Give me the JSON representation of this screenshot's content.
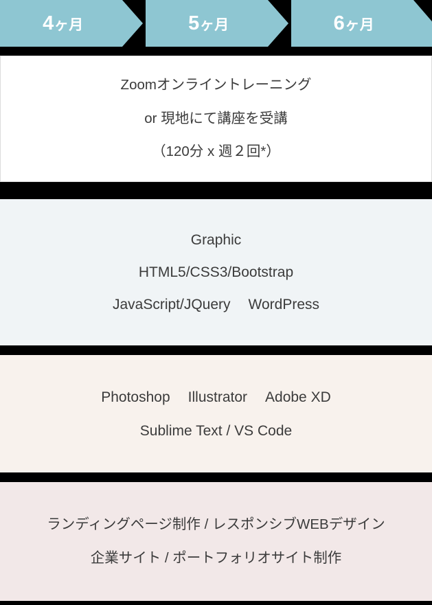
{
  "colors": {
    "chevron": "#8ec6d2",
    "chevron_text": "#ffffff",
    "separator": "#000000",
    "band_training_bg": "#ffffff",
    "band_skills_bg": "#f0f4f6",
    "band_tools_bg": "#f8f2ed",
    "band_deliverables_bg": "#f2e8e8",
    "body_text": "#3b3b3b"
  },
  "timeline": {
    "steps": [
      {
        "number": "4",
        "unit": "ヶ月",
        "full": "4ヶ月"
      },
      {
        "number": "5",
        "unit": "ヶ月",
        "full": "5ヶ月"
      },
      {
        "number": "6",
        "unit": "ヶ月",
        "full": "6ヶ月"
      }
    ]
  },
  "bands": {
    "training": {
      "lines": [
        "Zoomオンライントレーニング",
        "or 現地にて講座を受講",
        "（120分 x 週２回*）"
      ]
    },
    "skills": {
      "lines": [
        "Graphic",
        "HTML5/CSS3/Bootstrap"
      ],
      "row_items": [
        "JavaScript/JQuery",
        "WordPress"
      ]
    },
    "tools": {
      "row_items": [
        "Photoshop",
        "Illustrator",
        "Adobe XD"
      ],
      "lines": [
        "Sublime Text / VS Code"
      ]
    },
    "deliverables": {
      "lines": [
        "ランディングページ制作 / レスポンシブWEBデザイン",
        "企業サイト / ポートフォリオサイト制作"
      ]
    }
  }
}
